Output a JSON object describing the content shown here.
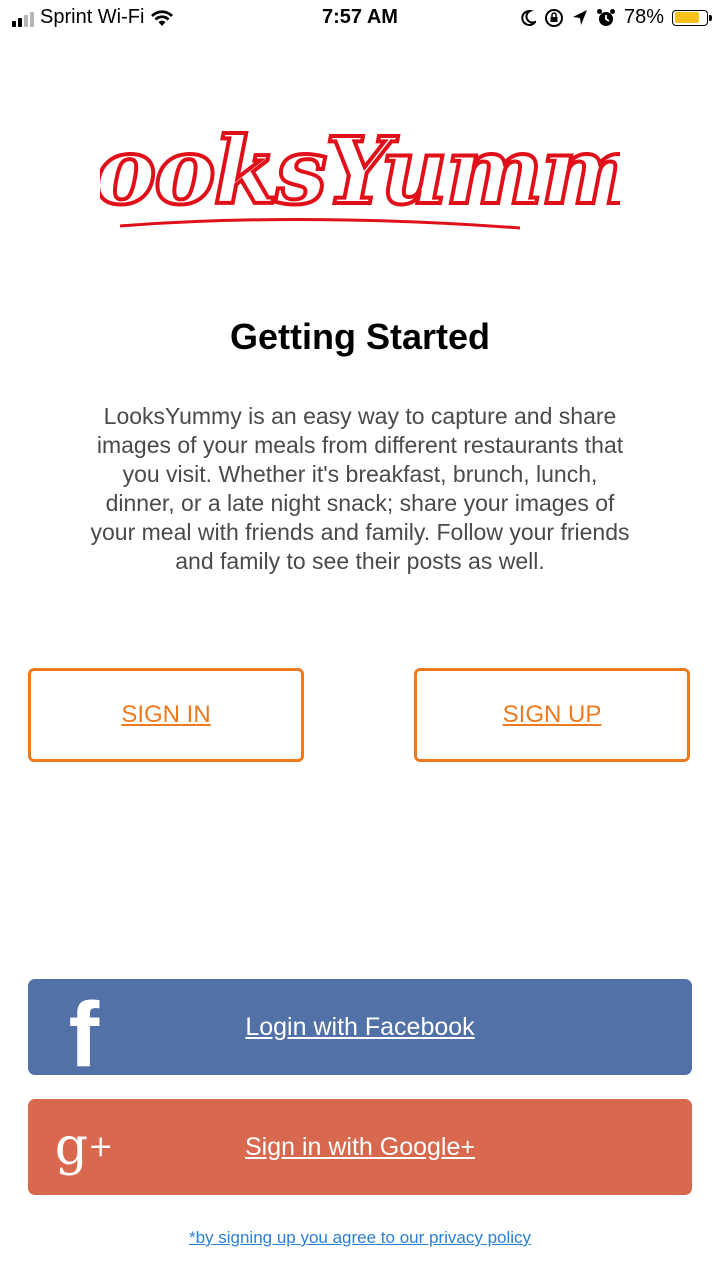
{
  "status_bar": {
    "carrier": "Sprint Wi-Fi",
    "time": "7:57 AM",
    "battery_percent": "78%",
    "battery_level": 0.78,
    "icons": [
      "signal-icon",
      "wifi-icon",
      "moon-icon",
      "rotation-lock-icon",
      "location-icon",
      "alarm-icon",
      "battery-icon"
    ]
  },
  "logo": {
    "text": "LooksYummy",
    "color": "#e0101a"
  },
  "title": "Getting Started",
  "description": "LooksYummy is an easy way to capture and share images of your meals from different restaurants that you visit. Whether it's breakfast, brunch, lunch, dinner, or a late night snack; share your images of your meal with friends and family. Follow your friends and family to see their posts as well.",
  "buttons": {
    "sign_in": "SIGN IN",
    "sign_up": "SIGN UP",
    "accent_color": "#ee7a1f"
  },
  "social": {
    "facebook_label": "Login with Facebook",
    "facebook_icon": "f",
    "facebook_color": "#5271a7",
    "google_label": "Sign in with Google+",
    "google_icon": "g",
    "google_plus": "+",
    "google_color": "#d8694f"
  },
  "privacy_text": "*by signing up you agree to our privacy policy"
}
